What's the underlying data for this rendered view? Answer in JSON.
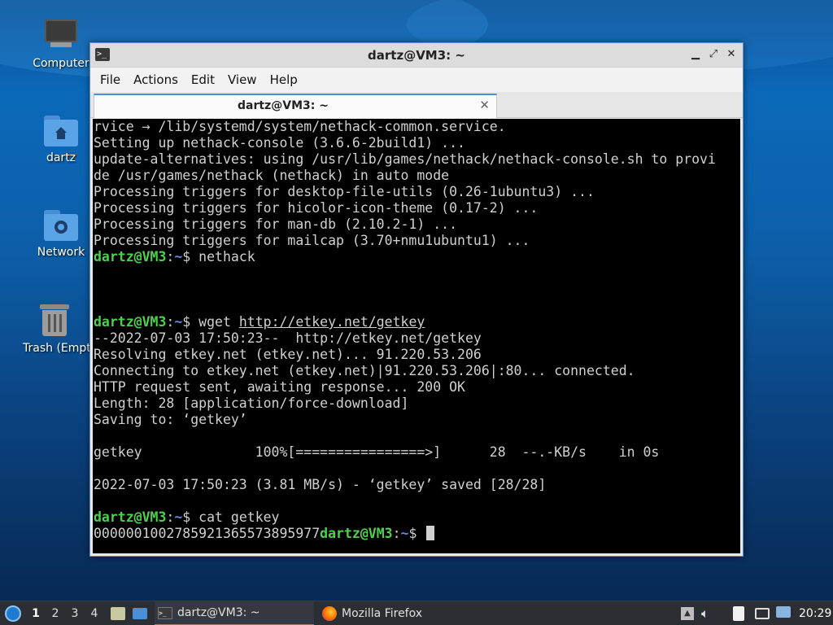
{
  "desktop": {
    "icons": [
      {
        "label": "Computer",
        "icon": "monitor-icon"
      },
      {
        "label": "dartz",
        "icon": "home-folder-icon"
      },
      {
        "label": "Network",
        "icon": "network-folder-icon"
      },
      {
        "label": "Trash (Empty)",
        "icon": "trash-icon"
      }
    ]
  },
  "window": {
    "title": "dartz@VM3: ~",
    "menu": [
      "File",
      "Actions",
      "Edit",
      "View",
      "Help"
    ],
    "tab": {
      "label": "dartz@VM3: ~",
      "close": "✕"
    }
  },
  "terminal": {
    "prompt_user": "dartz@VM3",
    "prompt_sep": ":",
    "prompt_path": "~",
    "prompt_sign": "$ ",
    "lines": [
      {
        "text": "rvice → /lib/systemd/system/nethack-common.service."
      },
      {
        "text": "Setting up nethack-console (3.6.6-2build1) ..."
      },
      {
        "text": "update-alternatives: using /usr/lib/games/nethack/nethack-console.sh to provi"
      },
      {
        "text": "de /usr/games/nethack (nethack) in auto mode"
      },
      {
        "text": "Processing triggers for desktop-file-utils (0.26-1ubuntu3) ..."
      },
      {
        "text": "Processing triggers for hicolor-icon-theme (0.17-2) ..."
      },
      {
        "text": "Processing triggers for man-db (2.10.2-1) ..."
      },
      {
        "text": "Processing triggers for mailcap (3.70+nmu1ubuntu1) ..."
      },
      {
        "cmd": "nethack"
      },
      {
        "text": ""
      },
      {
        "text": ""
      },
      {
        "text": ""
      },
      {
        "cmd": "wget ",
        "link": "http://etkey.net/getkey"
      },
      {
        "text": "--2022-07-03 17:50:23--  http://etkey.net/getkey"
      },
      {
        "text": "Resolving etkey.net (etkey.net)... 91.220.53.206"
      },
      {
        "text": "Connecting to etkey.net (etkey.net)|91.220.53.206|:80... connected."
      },
      {
        "text": "HTTP request sent, awaiting response... 200 OK"
      },
      {
        "text": "Length: 28 [application/force-download]"
      },
      {
        "text": "Saving to: ‘getkey’"
      },
      {
        "text": ""
      },
      {
        "text": "getkey              100%[================>]      28  --.-KB/s    in 0s"
      },
      {
        "text": ""
      },
      {
        "text": "2022-07-03 17:50:23 (3.81 MB/s) - ‘getkey’ saved [28/28]"
      },
      {
        "text": ""
      },
      {
        "cmd": "cat getkey"
      },
      {
        "output": "0000001002785921365573895977",
        "prompt_after": true
      }
    ]
  },
  "taskbar": {
    "workspaces": [
      "1",
      "2",
      "3",
      "4"
    ],
    "active_workspace": "1",
    "tasks": [
      {
        "label": "dartz@VM3: ~",
        "icon": "terminal-icon",
        "active": true
      },
      {
        "label": "Mozilla Firefox",
        "icon": "firefox-icon",
        "active": false
      }
    ],
    "clock": "20:29"
  }
}
